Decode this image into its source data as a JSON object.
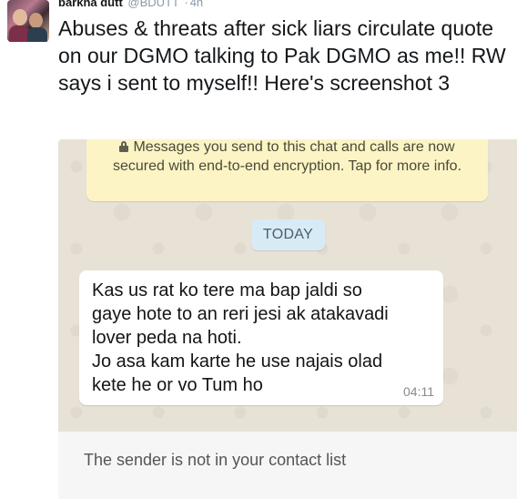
{
  "tweet": {
    "author_name": "barkha dutt",
    "author_handle": "@BDUTT",
    "separator": "·",
    "time": "4h",
    "text": "Abuses & threats after sick liars circulate quote on our DGMO talking to Pak DGMO as me!! RW says i sent to myself!! Here's screenshot 3"
  },
  "whatsapp": {
    "encryption_notice": "Messages you send to this chat and calls are now secured with end-to-end encryption. Tap for more info.",
    "date_label": "TODAY",
    "message": {
      "lines": [
        "Kas us rat ko tere ma bap jaldi so",
        "gaye hote to an reri jesi ak atakavadi",
        "lover peda na hoti.",
        "Jo asa kam karte he use najais olad",
        "kete he or vo Tum ho"
      ],
      "time": "04:11"
    },
    "contact_notice": "The sender is not in your contact list"
  },
  "colors": {
    "chat_background": "#e8e2d6",
    "encryption_notice_bg": "#fcf4c4",
    "date_chip_bg": "#d7ebf6",
    "bubble_bg": "#ffffff"
  }
}
